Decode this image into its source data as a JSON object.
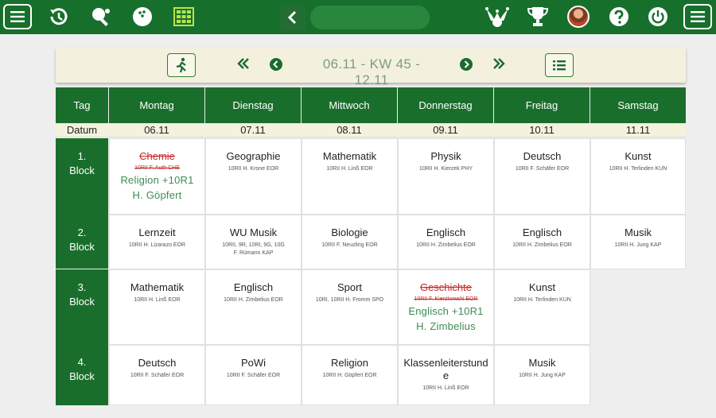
{
  "topbar": {
    "icons": [
      "menu-icon",
      "history-icon",
      "table-tennis-icon",
      "bowling-icon",
      "grid-icon",
      "back-chevron-icon",
      "jester-icon",
      "trophy-icon",
      "avatar",
      "help-icon",
      "power-icon",
      "menu-icon"
    ]
  },
  "nav": {
    "week_label": "06.11 - KW 45 - 12.11"
  },
  "table": {
    "tag_label": "Tag",
    "datum_label": "Datum",
    "days": [
      {
        "name": "Montag",
        "date": "06.11"
      },
      {
        "name": "Dienstag",
        "date": "07.11"
      },
      {
        "name": "Mittwoch",
        "date": "08.11"
      },
      {
        "name": "Donnerstag",
        "date": "09.11"
      },
      {
        "name": "Freitag",
        "date": "10.11"
      },
      {
        "name": "Samstag",
        "date": "11.11"
      }
    ],
    "blocks": [
      {
        "label_num": "1.",
        "label": "Block"
      },
      {
        "label_num": "2.",
        "label": "Block"
      },
      {
        "label_num": "3.",
        "label": "Block"
      },
      {
        "label_num": "4.",
        "label": "Block"
      }
    ],
    "cells": {
      "b1": {
        "mon": {
          "subject": "Chemie",
          "info": "10RII F. Auth CHE",
          "cancelled": true,
          "sub1": "Religion +10R1",
          "sub2": "H. Göpfert"
        },
        "tue": {
          "subject": "Geographie",
          "info": "10RII H. Krone EOR"
        },
        "wed": {
          "subject": "Mathematik",
          "info": "10RII H. Linß EOR"
        },
        "thu": {
          "subject": "Physik",
          "info": "10RII H. Kierzek PHY"
        },
        "fri": {
          "subject": "Deutsch",
          "info": "10RII F. Schäfer EOR"
        },
        "sat": {
          "subject": "Kunst",
          "info": "10RII H. Terlinden KUN"
        }
      },
      "b2": {
        "mon": {
          "subject": "Lernzeit",
          "info": "10RII H. Lizarazo EOR"
        },
        "tue": {
          "subject": "WU Musik",
          "info": "10RII, 9R, 10RI, 9G, 10G",
          "info2": "F. Rümann KAP"
        },
        "wed": {
          "subject": "Biologie",
          "info": "10RII F. Neuzling EOR"
        },
        "thu": {
          "subject": "Englisch",
          "info": "10RII H. Zimbelius EOR"
        },
        "fri": {
          "subject": "Englisch",
          "info": "10RII H. Zimbelius EOR"
        },
        "sat": {
          "subject": "Musik",
          "info": "10RII H. Jung KAP"
        }
      },
      "b3": {
        "mon": {
          "subject": "Mathematik",
          "info": "10RII H. Linß EOR"
        },
        "tue": {
          "subject": "Englisch",
          "info": "10RII H. Zimbelius EOR"
        },
        "wed": {
          "subject": "Sport",
          "info": "10RI, 10RII H. Fromm SPO"
        },
        "thu": {
          "subject": "Geschichte",
          "info": "10RII F. Kierzkowski EOR",
          "cancelled": true,
          "sub1": "Englisch +10R1",
          "sub2": "H. Zimbelius"
        },
        "fri": {
          "subject": "Kunst",
          "info": "10RII H. Terlinden KUN"
        }
      },
      "b4": {
        "mon": {
          "subject": "Deutsch",
          "info": "10RII F. Schäfer EOR"
        },
        "tue": {
          "subject": "PoWi",
          "info": "10RII F. Schäfer EOR"
        },
        "wed": {
          "subject": "Religion",
          "info": "10RII H. Göpfert EOR"
        },
        "thu": {
          "subject": "Klassenleiterstund",
          "subject2": "e",
          "info": "10RII H. Linß EOR"
        },
        "fri": {
          "subject": "Musik",
          "info": "10RII H. Jung KAP"
        }
      }
    }
  },
  "colors": {
    "brand_green": "#176f2c",
    "header_green": "#1a6e2c",
    "cancel_red": "#c62828",
    "substitute_green": "#3d8b53"
  }
}
